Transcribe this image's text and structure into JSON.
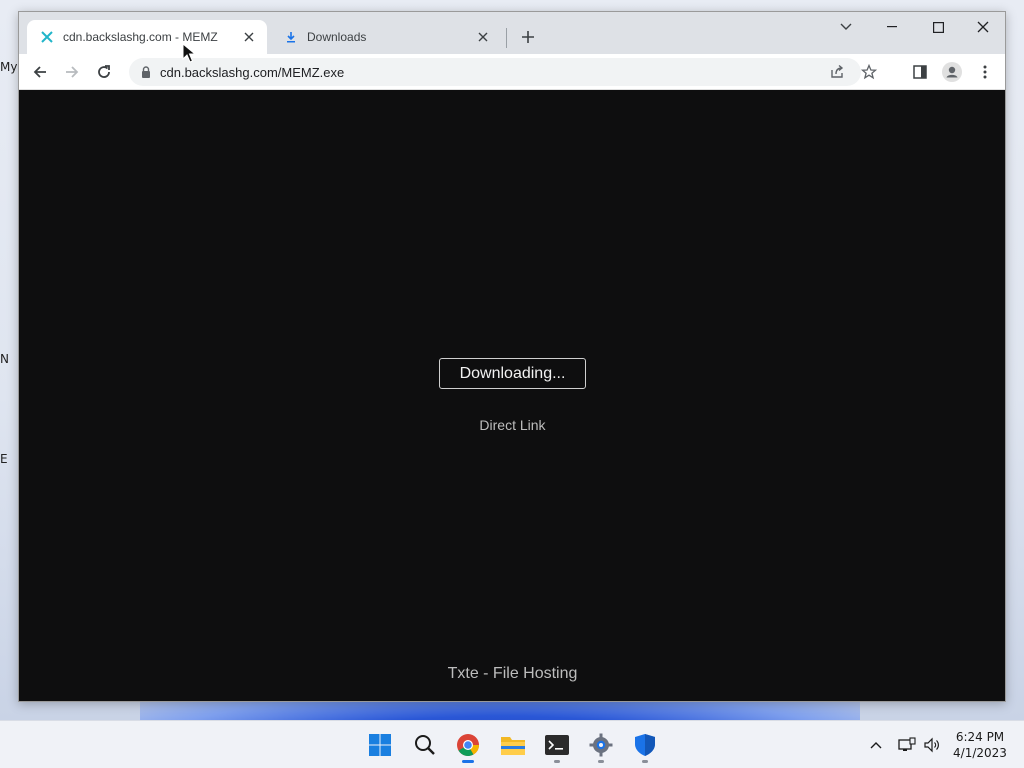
{
  "desktop": {
    "fragments": [
      "My",
      "N",
      "E"
    ]
  },
  "browser": {
    "tabs": [
      {
        "title": "cdn.backslashg.com - MEMZ",
        "active": true
      },
      {
        "title": "Downloads",
        "active": false
      }
    ],
    "url": "cdn.backslashg.com/MEMZ.exe",
    "icons": {
      "back": "arrow-left-icon",
      "forward": "arrow-right-icon",
      "reload": "reload-icon",
      "share": "share-icon",
      "bookmark": "star-icon",
      "side_panel": "side-panel-icon",
      "profile": "profile-icon",
      "menu": "kebab-menu-icon"
    }
  },
  "page": {
    "download_button": "Downloading...",
    "direct_link": "Direct Link",
    "footer": "Txte - File Hosting"
  },
  "taskbar": {
    "apps": [
      "start",
      "search",
      "chrome",
      "file-explorer",
      "terminal",
      "settings",
      "defender"
    ],
    "clock": {
      "time": "6:24 PM",
      "date": "4/1/2023"
    }
  },
  "colors": {
    "page_bg": "#0e0e0f",
    "tab_strip": "#dee1e6",
    "accent_blue": "#1a73e8",
    "tab_favicon": "#22b5c9"
  }
}
